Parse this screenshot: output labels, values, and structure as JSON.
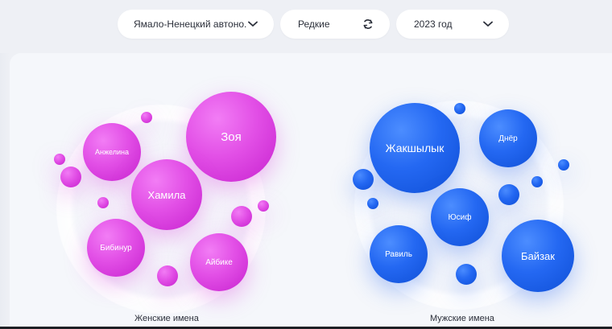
{
  "filters": {
    "region": "Ямало-Ненецкий автоно...",
    "type": "Редкие",
    "year": "2023 год"
  },
  "sections": {
    "female_caption": "Женские имена",
    "male_caption": "Мужские имена"
  },
  "female_names": [
    "Зоя",
    "Анжелина",
    "Хамила",
    "Бибинур",
    "Айбике"
  ],
  "male_names": [
    "Жакшылык",
    "Днёр",
    "Юсиф",
    "Равиль",
    "Байзак"
  ],
  "colors": {
    "female": "#e24fe6",
    "male": "#2468f2",
    "background": "#eef0f5",
    "card": "#f5f7fb"
  },
  "icons": {
    "region_dropdown": "chevron-down-icon",
    "type_toggle": "refresh-icon",
    "year_dropdown": "chevron-down-icon"
  }
}
